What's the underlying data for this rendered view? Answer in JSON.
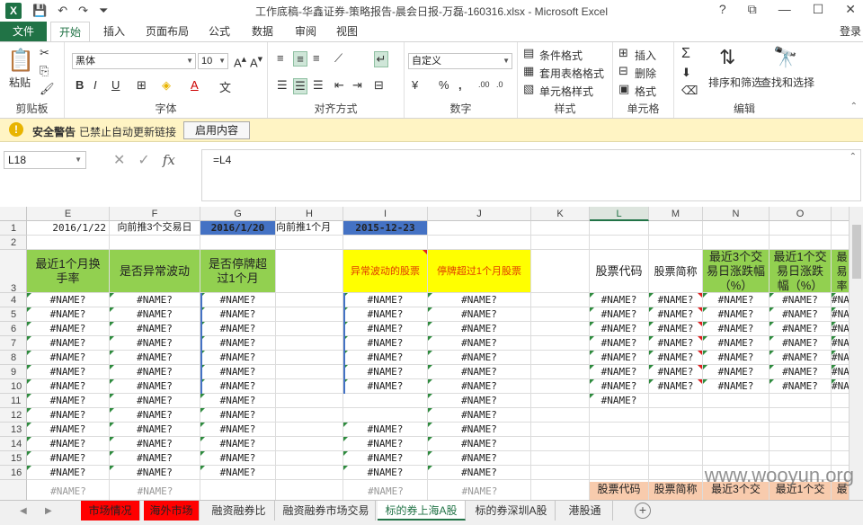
{
  "window": {
    "title": "工作底稿-华鑫证券-策略报告-晨会日报-万磊-160316.xlsx - Microsoft Excel",
    "help": "?",
    "restore": "⧉",
    "minimize": "—",
    "maximize": "☐",
    "close": "✕"
  },
  "ribbon_tabs": [
    "文件",
    "开始",
    "插入",
    "页面布局",
    "公式",
    "数据",
    "审阅",
    "视图"
  ],
  "login": "登录",
  "ribbon": {
    "clipboard": {
      "label": "剪贴板",
      "paste": "粘贴"
    },
    "font": {
      "label": "字体",
      "name": "黑体",
      "size": "10",
      "bold": "B",
      "italic": "I",
      "underline": "U"
    },
    "alignment": {
      "label": "对齐方式"
    },
    "number": {
      "label": "数字",
      "format": "自定义",
      "percent": "%",
      "comma": ","
    },
    "styles": {
      "label": "样式",
      "conditional": "条件格式",
      "table": "套用表格格式",
      "cell_styles": "单元格样式"
    },
    "cells": {
      "label": "单元格",
      "insert": "插入",
      "delete": "删除",
      "format": "格式"
    },
    "editing": {
      "label": "编辑",
      "sort": "排序和筛选",
      "find": "查找和选择"
    }
  },
  "security": {
    "title": "安全警告",
    "message": "已禁止自动更新链接",
    "button": "启用内容"
  },
  "formula_bar": {
    "namebox": "L18",
    "fx": "fx",
    "formula": "=L4"
  },
  "columns": [
    "E",
    "F",
    "G",
    "H",
    "I",
    "J",
    "K",
    "L",
    "M",
    "N",
    "O"
  ],
  "rows": [
    "1",
    "2",
    "3",
    "4",
    "5",
    "6",
    "7",
    "8",
    "9",
    "10",
    "11",
    "12",
    "13",
    "14",
    "15",
    "16"
  ],
  "row1": {
    "E": "2016/1/22",
    "F": "向前推3个交易日",
    "G": "2016/1/20",
    "H": "向前推1个月",
    "I": "2015-12-23"
  },
  "headers": {
    "E": "最近1个月换手率",
    "F": "是否异常波动",
    "G": "是否停牌超过1个月",
    "I": "异常波动的股票",
    "J": "停牌超过1个月股票",
    "L": "股票代码",
    "M": "股票简称",
    "N": "最近3个交易日涨跌幅（%）",
    "O": "最近1个交易日涨跌幅（%）",
    "P": "最易率"
  },
  "error_value": "#NAME?",
  "bottom_headers": {
    "L": "股票代码",
    "M": "股票简称",
    "N": "最近3个交",
    "O": "最近1个交",
    "P": "最"
  },
  "sheet_tabs": [
    "市场情况",
    "海外市场",
    "融资融券比",
    "融资融券市场交易",
    "标的券上海A股",
    "标的券深圳A股",
    "港股通"
  ],
  "watermark": "www.wooyun.org"
}
